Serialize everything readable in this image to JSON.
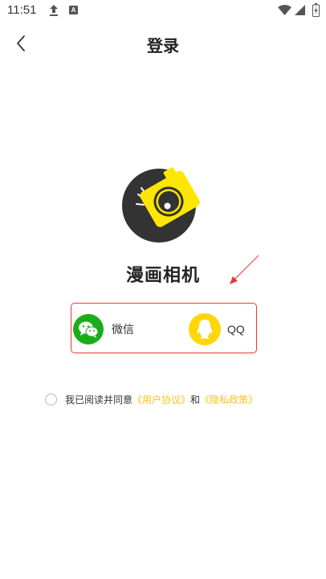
{
  "status_bar": {
    "time": "11:51",
    "icons": [
      "upload-icon",
      "a-notification-icon",
      "wifi-icon",
      "signal-icon",
      "battery-icon"
    ]
  },
  "header": {
    "title": "登录",
    "back_icon": "chevron-left-icon"
  },
  "app": {
    "name": "漫画相机",
    "logo_colors": {
      "dark": "#333333",
      "accent": "#ffe600"
    }
  },
  "login_options": [
    {
      "label": "微信",
      "icon": "wechat-icon",
      "color": "#1aad19"
    },
    {
      "label": "QQ",
      "icon": "qq-icon",
      "color": "#ffd60a"
    }
  ],
  "agreement": {
    "prefix": "我已阅读并同意",
    "user_agreement": "《用户协议》",
    "and": "和",
    "privacy_policy": "《隐私政策》",
    "link_color": "#f5c518"
  },
  "annotation": {
    "border_color": "#e53935"
  }
}
